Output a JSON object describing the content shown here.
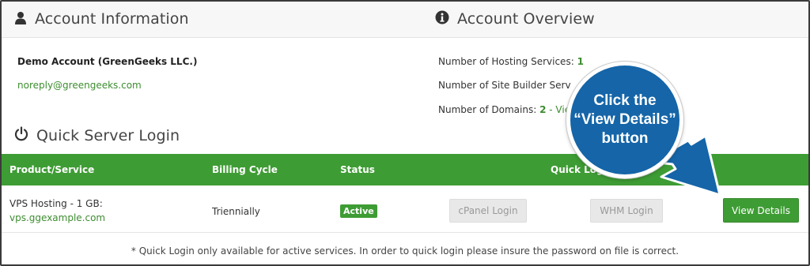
{
  "account_information": {
    "title": "Account Information",
    "icon": "user-icon",
    "name": "Demo Account (GreenGeeks LLC.)",
    "email": "noreply@greengeeks.com"
  },
  "account_overview": {
    "title": "Account Overview",
    "icon": "info-circle-icon",
    "hosting_services_label": "Number of Hosting Services:",
    "hosting_services_value": "1",
    "site_builder_label": "Number of Site Builder Serv",
    "domains_label": "Number of Domains:",
    "domains_value": "2",
    "domains_link": "- Vie"
  },
  "quick_server_login": {
    "title": "Quick Server Login",
    "icon": "power-icon",
    "columns": [
      "Product/Service",
      "Billing Cycle",
      "Status",
      "Quick Login"
    ],
    "rows": [
      {
        "product": "VPS Hosting - 1 GB:",
        "domain": "vps.ggexample.com",
        "billing_cycle": "Triennially",
        "status": "Active",
        "cpanel_label": "cPanel Login",
        "whm_label": "WHM Login",
        "details_label": "View Details"
      }
    ],
    "footnote": "* Quick Login only available for active services. In order to quick login please insure the password on file is correct."
  },
  "callout": {
    "text": "Click the “View Details” button"
  },
  "colors": {
    "brand_green": "#3e9c34",
    "link_green": "#3c8d2f",
    "callout_blue": "#1565a8"
  }
}
